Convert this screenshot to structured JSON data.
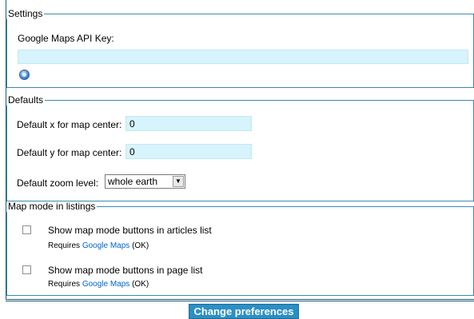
{
  "settings": {
    "legend": "Settings",
    "api_key_label": "Google Maps API Key:",
    "api_key_value": ""
  },
  "defaults": {
    "legend": "Defaults",
    "x_label": "Default x for map center:",
    "x_value": "0",
    "y_label": "Default y for map center:",
    "y_value": "0",
    "zoom_label": "Default zoom level:",
    "zoom_value": "whole earth"
  },
  "map_mode": {
    "legend": "Map mode in listings",
    "items": [
      {
        "label": "Show map mode buttons in articles list",
        "checked": false,
        "requires_prefix": "Requires",
        "requires_link": "Google Maps",
        "requires_status": "(OK)"
      },
      {
        "label": "Show map mode buttons in page list",
        "checked": false,
        "requires_prefix": "Requires",
        "requires_link": "Google Maps",
        "requires_status": "(OK)"
      }
    ]
  },
  "submit_label": "Change preferences"
}
